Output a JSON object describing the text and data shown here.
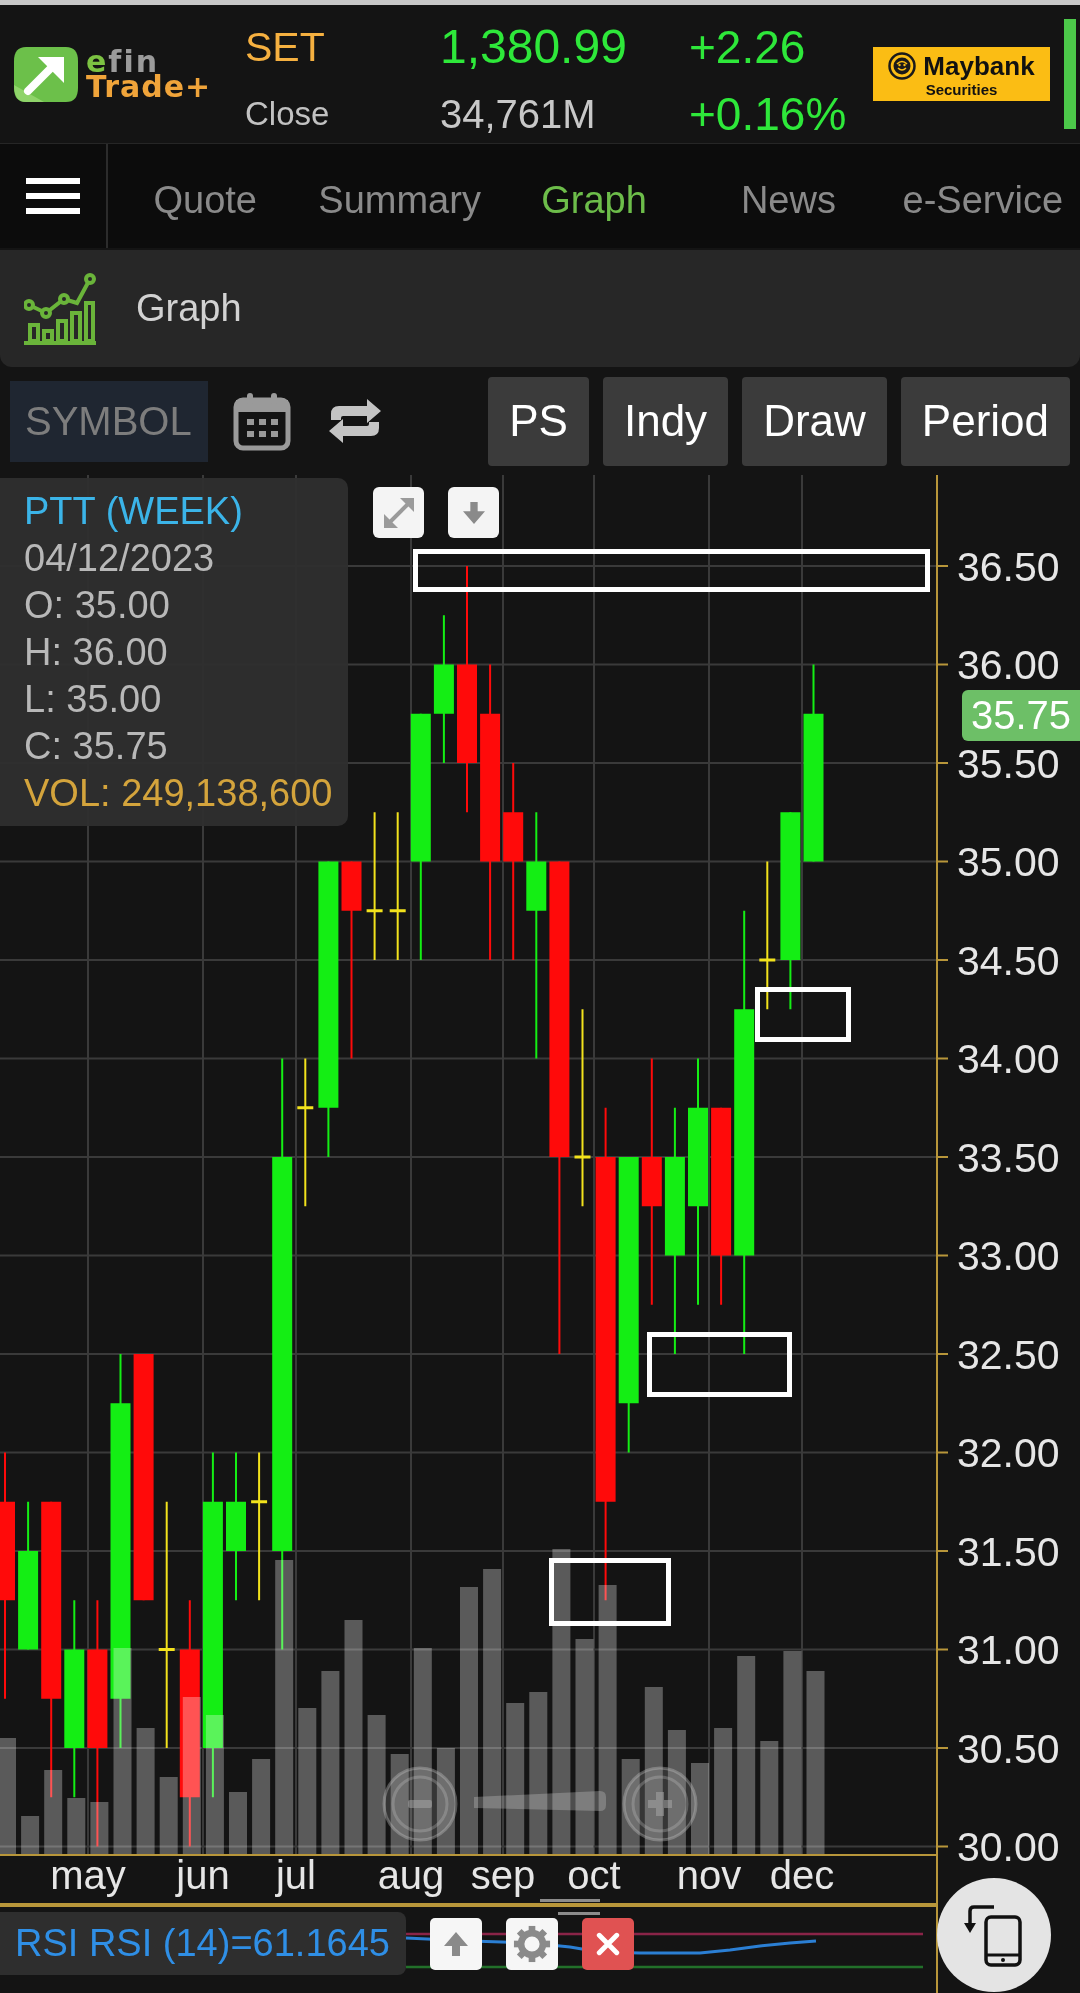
{
  "header": {
    "logo": {
      "top": "efin",
      "bottom": "Trade+"
    },
    "index": {
      "name": "SET",
      "status": "Close",
      "value": "1,380.99",
      "turnover": "34,761M",
      "change": "+2.26",
      "change_percent": "+0.16%"
    },
    "broker": {
      "name": "Maybank",
      "subtitle": "Securities"
    }
  },
  "nav": {
    "tabs": [
      {
        "label": "Quote",
        "selected": false
      },
      {
        "label": "Summary",
        "selected": false
      },
      {
        "label": "Graph",
        "selected": true
      },
      {
        "label": "News",
        "selected": false
      },
      {
        "label": "e-Service",
        "selected": false
      }
    ]
  },
  "section": {
    "title": "Graph"
  },
  "toolbar": {
    "symbol": {
      "placeholder": "SYMBOL"
    },
    "buttons": [
      "PS",
      "Indy",
      "Draw",
      "Period"
    ]
  },
  "chart": {
    "info": {
      "title": "PTT (WEEK)",
      "date": "04/12/2023",
      "open": "O: 35.00",
      "high": "H: 36.00",
      "low": "L: 35.00",
      "close": "C: 35.75",
      "volume": "VOL: 249,138,600"
    },
    "last_price": "35.75",
    "price_axis": [
      "36.50",
      "36.00",
      "35.50",
      "35.00",
      "34.50",
      "34.00",
      "33.50",
      "33.00",
      "32.50",
      "32.00",
      "31.50",
      "31.00",
      "30.50",
      "30.00"
    ],
    "months": [
      "may",
      "jun",
      "jul",
      "aug",
      "sep",
      "oct",
      "nov",
      "dec"
    ]
  },
  "indicator": {
    "label": "RSI RSI (14)=61.1645"
  }
}
